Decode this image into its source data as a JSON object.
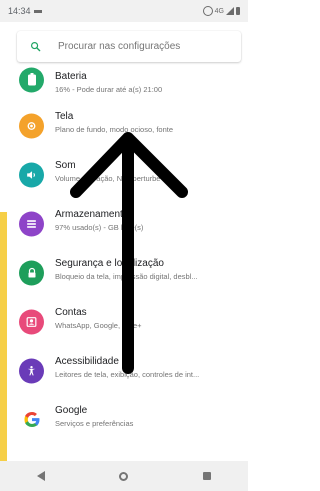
{
  "status_bar": {
    "time": "14:34",
    "network": "4G",
    "icons": [
      "notification-icon",
      "alarm-icon",
      "signal-icon",
      "battery-icon"
    ]
  },
  "search": {
    "placeholder": "Procurar nas configurações",
    "icon": "search-icon",
    "accent": "#1ea362"
  },
  "settings": [
    {
      "key": "battery",
      "title": "Bateria",
      "subtitle": "16% - Pode durar até a(s) 21:00",
      "icon": "battery-icon",
      "color": "#23a96a"
    },
    {
      "key": "display",
      "title": "Tela",
      "subtitle": "Plano de fundo, modo ocioso, fonte",
      "icon": "display-icon",
      "color": "#f4a22b"
    },
    {
      "key": "sound",
      "title": "Som",
      "subtitle": "Volume, vibração, Não perturbe",
      "icon": "sound-icon",
      "color": "#18a8a8"
    },
    {
      "key": "storage",
      "title": "Armazenamento",
      "subtitle": "97% usado(s) - GB livre(s)",
      "icon": "storage-icon",
      "color": "#8e44c8"
    },
    {
      "key": "security",
      "title": "Segurança e localização",
      "subtitle": "Bloqueio da tela, impressão digital, desbl...",
      "icon": "lock-icon",
      "color": "#1e9e5b"
    },
    {
      "key": "accounts",
      "title": "Contas",
      "subtitle": "WhatsApp, Google, Nike+",
      "icon": "accounts-icon",
      "color": "#e84a7a"
    },
    {
      "key": "accessibility",
      "title": "Acessibilidade",
      "subtitle": "Leitores de tela, exibição, controles de int...",
      "icon": "accessibility-icon",
      "color": "#6a3bb8"
    },
    {
      "key": "google",
      "title": "Google",
      "subtitle": "Serviços e preferências",
      "icon": "google-icon",
      "color": "#4285f4"
    }
  ],
  "overlay": {
    "arrow": "up-arrow-annotation",
    "color": "#000000"
  },
  "nav": {
    "buttons": [
      "back-icon",
      "home-icon",
      "recents-icon"
    ]
  }
}
